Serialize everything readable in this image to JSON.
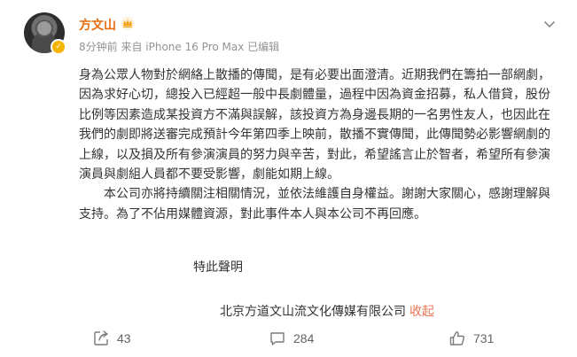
{
  "header": {
    "username": "方文山",
    "meta": "8分钟前  来自 iPhone 16 Pro Max 已编辑",
    "icons": {
      "avatar": "avatar",
      "verified": "verified-badge-icon",
      "vip": "crown-icon",
      "more": "chevron-down-icon"
    }
  },
  "post": {
    "paragraph1": "身為公眾人物對於網絡上散播的傳聞，是有必要出面澄清。近期我們在籌拍一部網劇，因為求好心切，總投入已經超一般中長劇體量，過程中因為資金招募，私人借貸，股份比例等因素造成某投資方不滿與誤解，該投資方為身邊長期的一名男性友人，也因此在我們的劇即將送審完成預計今年第四季上映前，散播不實傳聞，此傳聞勢必影響網劇的上線，以及損及所有參演演員的努力與辛苦，對此，希望謠言止於智者，希望所有參演演員與劇組人員都不要受影響，劇能如期上線。",
    "paragraph2": "本公司亦將持續關注相關情況，並依法維護自身權益。謝謝大家關心，感謝理解與支持。為了不佔用媒體資源，對此事件本人與本公司不再回應。",
    "signature_line1": "特此聲明",
    "signature_line2": "北京方道文山流文化傳媒有限公司",
    "collapse_label": "收起"
  },
  "footer": {
    "share_count": "43",
    "comment_count": "284",
    "like_count": "731",
    "icons": {
      "share": "share-icon",
      "comment": "comment-icon",
      "like": "thumbs-up-icon"
    }
  },
  "colors": {
    "username": "#e86b0e",
    "link": "#eb7350",
    "meta": "#939393",
    "text": "#333333"
  }
}
